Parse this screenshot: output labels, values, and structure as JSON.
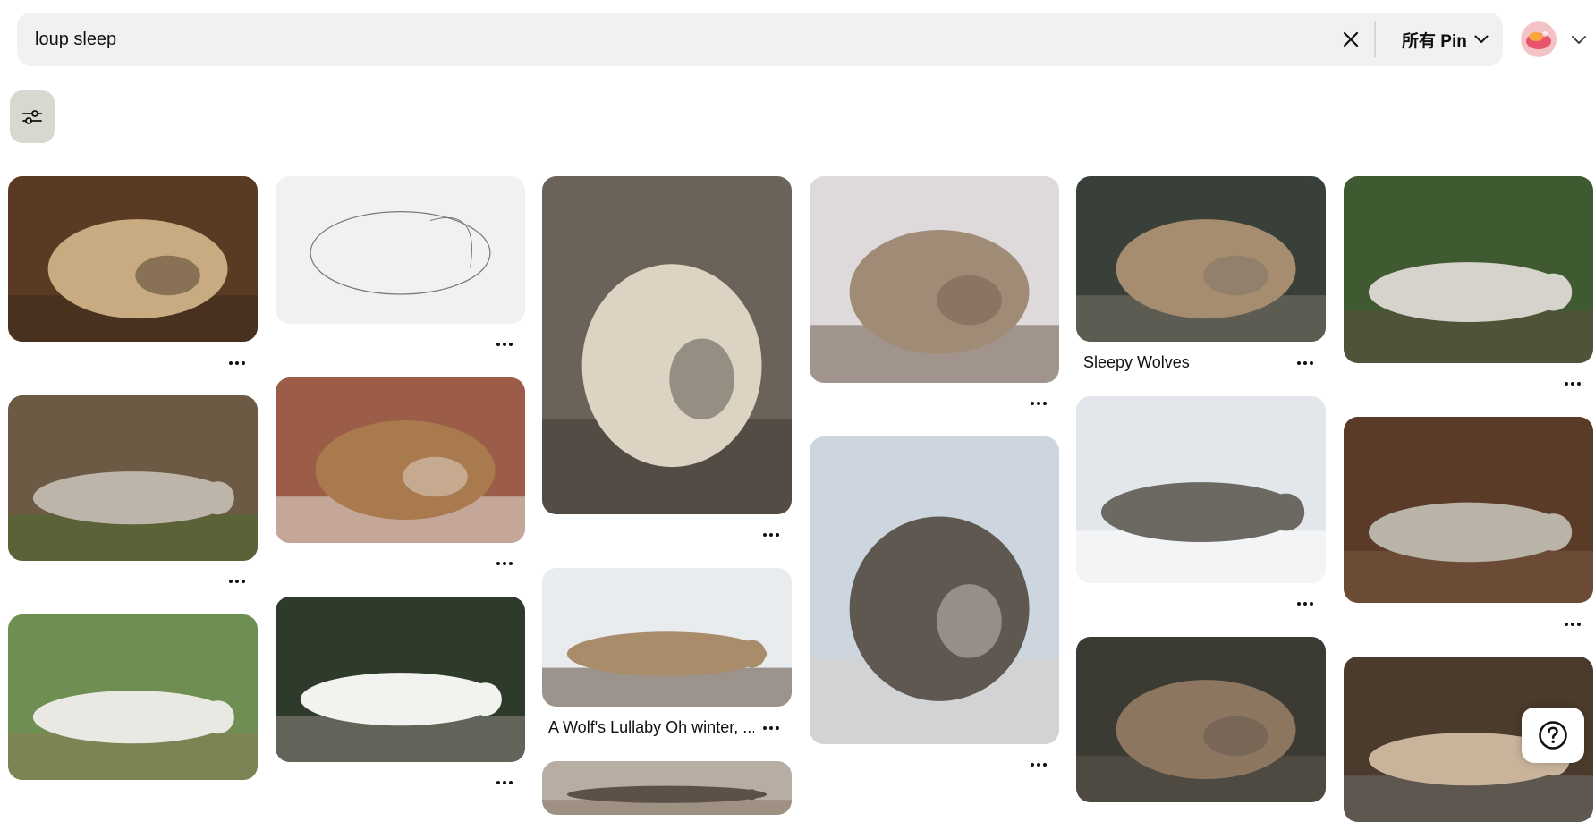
{
  "search": {
    "query": "loup sleep",
    "placeholder": "",
    "clear_icon": "close-icon",
    "filter_label": "所有 Pin",
    "filter_icon": "chevron-down-icon"
  },
  "account": {
    "avatar_icon": "avatar",
    "menu_icon": "chevron-down-icon"
  },
  "toolbar": {
    "filters_icon": "sliders-icon"
  },
  "pins": [
    {
      "title": "",
      "palette": [
        "#5a3a22",
        "#c9ab82",
        "#3a2a1e"
      ],
      "shape": "curl"
    },
    {
      "title": "",
      "palette": [
        "#f1f1f1",
        "#f5f5f5",
        "#777777"
      ],
      "shape": "sketch"
    },
    {
      "title": "",
      "palette": [
        "#6b6259",
        "#ddd3c2",
        "#3e3a35"
      ],
      "shape": "curl"
    },
    {
      "title": "",
      "palette": [
        "#dedadc",
        "#a08b76",
        "#6e5b4b"
      ],
      "shape": "curl"
    },
    {
      "title": "Sleepy Wolves",
      "palette": [
        "#39403a",
        "#a68d70",
        "#7c7268"
      ],
      "shape": "curl"
    },
    {
      "title": "",
      "palette": [
        "#3f5a30",
        "#d6d3cc",
        "#5c4f40"
      ],
      "shape": "lying"
    },
    {
      "title": "",
      "palette": [
        "#6d5a45",
        "#bdb5aa",
        "#4c6a2c"
      ],
      "shape": "lying"
    },
    {
      "title": "",
      "palette": [
        "#9c5d48",
        "#a87a4e",
        "#e8e4df"
      ],
      "shape": "curl"
    },
    {
      "title": "A Wolf's Lullaby Oh winter, ...",
      "palette": [
        "#e9ecef",
        "#a98c6a",
        "#5b4a3a"
      ],
      "shape": "lying"
    },
    {
      "title": "",
      "palette": [
        "#cdd6df",
        "#5f5851",
        "#d6d2cc"
      ],
      "shape": "curl"
    },
    {
      "title": "",
      "palette": [
        "#e3e7ec",
        "#6c6862",
        "#ffffff"
      ],
      "shape": "lying"
    },
    {
      "title": "",
      "palette": [
        "#5a3b28",
        "#bab3a8",
        "#7a5a40"
      ],
      "shape": "lying"
    },
    {
      "title": "",
      "palette": [
        "#6f8f52",
        "#e9e8e2",
        "#8a7a56"
      ],
      "shape": "lying"
    },
    {
      "title": "",
      "palette": [
        "#2e3b2a",
        "#f2f2ef",
        "#8b8780"
      ],
      "shape": "lying"
    },
    {
      "title": "",
      "palette": [
        "#b7ada3",
        "#5c5148",
        "#8a7867"
      ],
      "shape": "lying"
    },
    {
      "title": "",
      "palette": [
        "#3b3a33",
        "#8c7660",
        "#5f564d"
      ],
      "shape": "curl"
    },
    {
      "title": "",
      "palette": [
        "#4b3b2c",
        "#c9b49b",
        "#707070"
      ],
      "shape": "lying"
    }
  ],
  "help": {
    "icon": "help-icon"
  }
}
